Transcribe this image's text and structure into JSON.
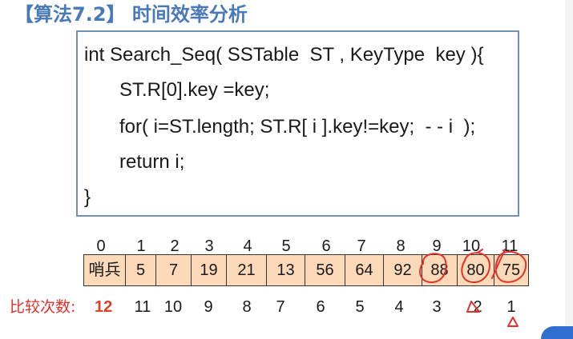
{
  "title": "【算法7.2】 时间效率分析",
  "code": {
    "lines": [
      "int Search_Seq( SSTable  ST , KeyType  key ){",
      "ST.R[0].key =key;",
      "for( i=ST.length; ST.R[ i ].key!=key;  - - i  );",
      "return i;",
      "}"
    ]
  },
  "array": {
    "indices": [
      "0",
      "1",
      "2",
      "3",
      "4",
      "5",
      "6",
      "7",
      "8",
      "9",
      "10",
      "11"
    ],
    "cells": [
      "哨兵",
      "5",
      "7",
      "19",
      "21",
      "13",
      "56",
      "64",
      "92",
      "88",
      "80",
      "75"
    ],
    "circled_indices": [
      9,
      10,
      11
    ]
  },
  "comparisons": {
    "label": "比较次数:",
    "first": "12",
    "values": [
      "11",
      "10",
      "9",
      "8",
      "7",
      "6",
      "5",
      "4",
      "3",
      "2",
      "1"
    ]
  },
  "colors": {
    "title": "#4a79b8",
    "code_border": "#6e8fbf",
    "cell_fill": "#fbd9b9",
    "label_red": "#e0312a",
    "annotation_red": "#e0312a"
  }
}
